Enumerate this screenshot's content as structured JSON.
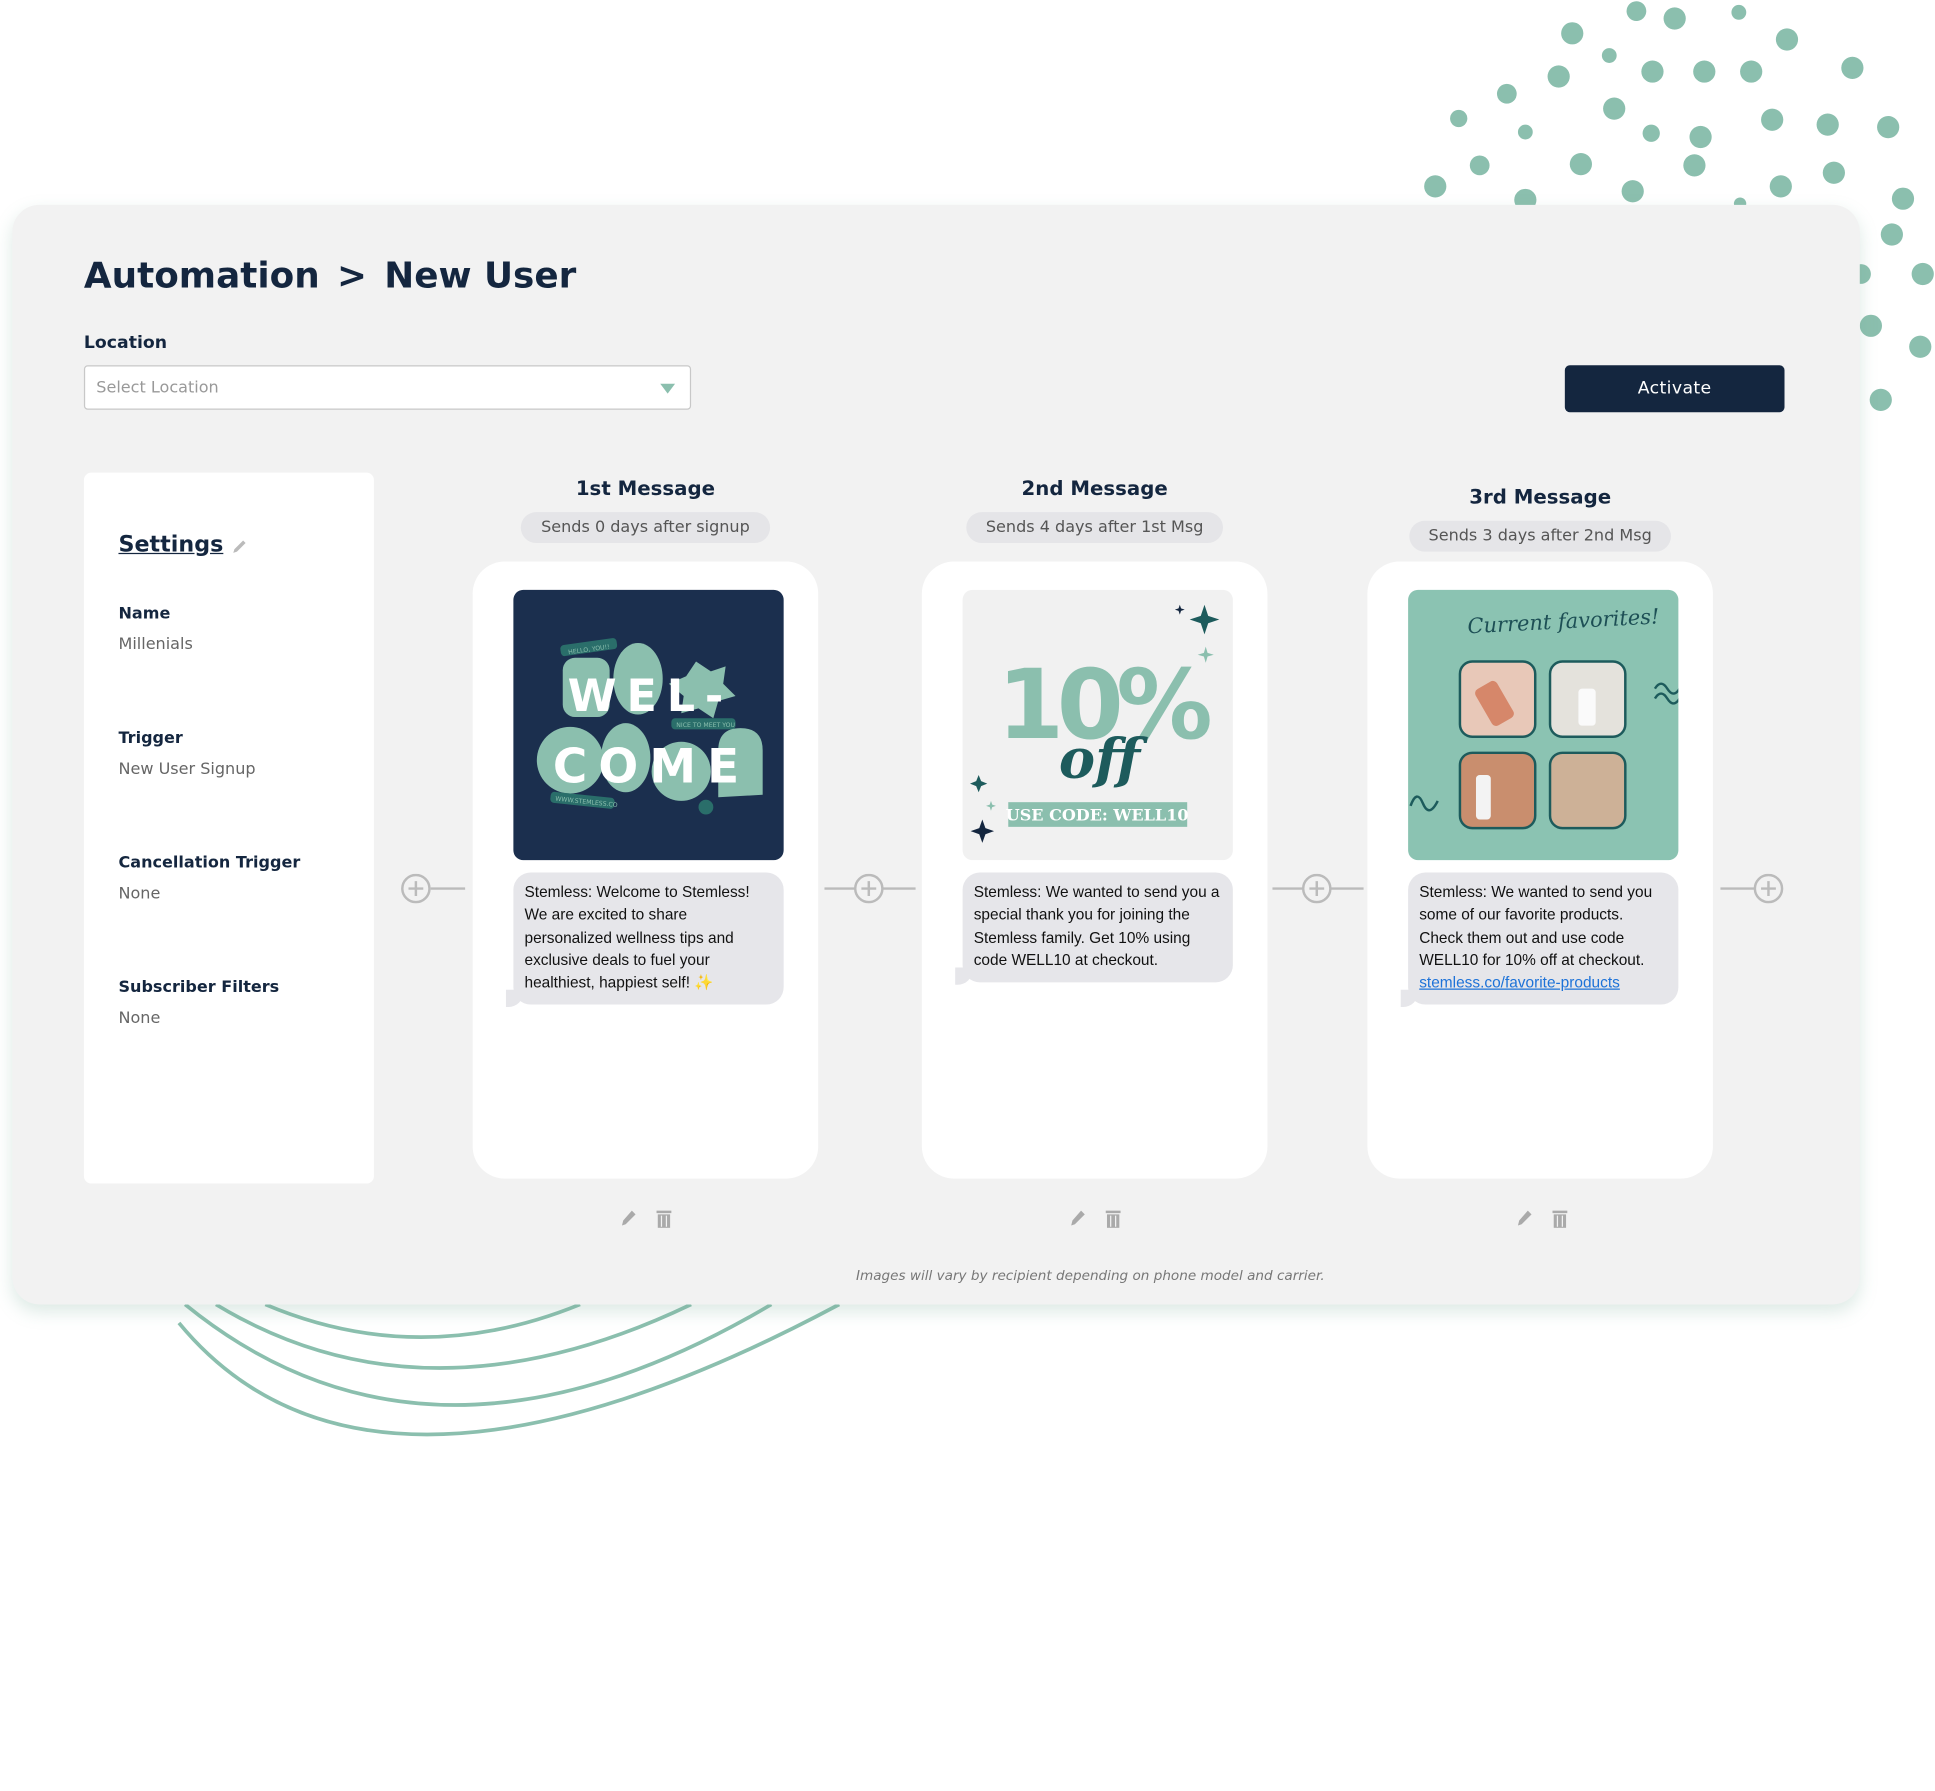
{
  "breadcrumb": {
    "root": "Automation",
    "separator": ">",
    "current": "New User"
  },
  "location": {
    "label": "Location",
    "placeholder": "Select Location"
  },
  "activate_label": "Activate",
  "settings": {
    "title": "Settings",
    "fields": [
      {
        "label": "Name",
        "value": "Millenials"
      },
      {
        "label": "Trigger",
        "value": "New User Signup"
      },
      {
        "label": "Cancellation Trigger",
        "value": "None"
      },
      {
        "label": "Subscriber Filters",
        "value": "None"
      }
    ]
  },
  "messages": [
    {
      "title": "1st Message",
      "schedule": "Sends 0 days after signup",
      "image_text": {
        "line1": "WEL-",
        "line2": "COME",
        "tag1": "HELLO, YOU!!",
        "tag2": "NICE TO MEET YOU",
        "tag3": "WWW.STEMLESS.CO"
      },
      "text": "Stemless: Welcome to Stemless! We are excited to share personalized wellness tips and exclusive deals to fuel your healthiest, happiest self! ✨",
      "link": ""
    },
    {
      "title": "2nd Message",
      "schedule": "Sends 4 days after 1st Msg",
      "image_text": {
        "big": "10%",
        "off": "off",
        "code": "USE CODE: WELL10"
      },
      "text": "Stemless: We wanted to send you a special thank you for joining the Stemless family. Get 10% using code WELL10 at checkout.",
      "link": ""
    },
    {
      "title": "3rd Message",
      "schedule": "Sends 3 days after 2nd Msg",
      "image_text": {
        "heading": "Current favorites!"
      },
      "text": "Stemless: We wanted to send you some of our favorite products. Check them out and use code WELL10 for 10% off at checkout.",
      "link": "stemless.co/favorite-products"
    }
  ],
  "footnote": "Images will vary by recipient depending on phone model and carrier.",
  "colors": {
    "navy": "#14263f",
    "teal": "#8bbfae",
    "panel": "#f2f2f2"
  },
  "icons": {
    "edit": "pencil-icon",
    "delete": "trash-icon",
    "add": "plus-circle-icon",
    "dropdown": "caret-down-icon"
  }
}
